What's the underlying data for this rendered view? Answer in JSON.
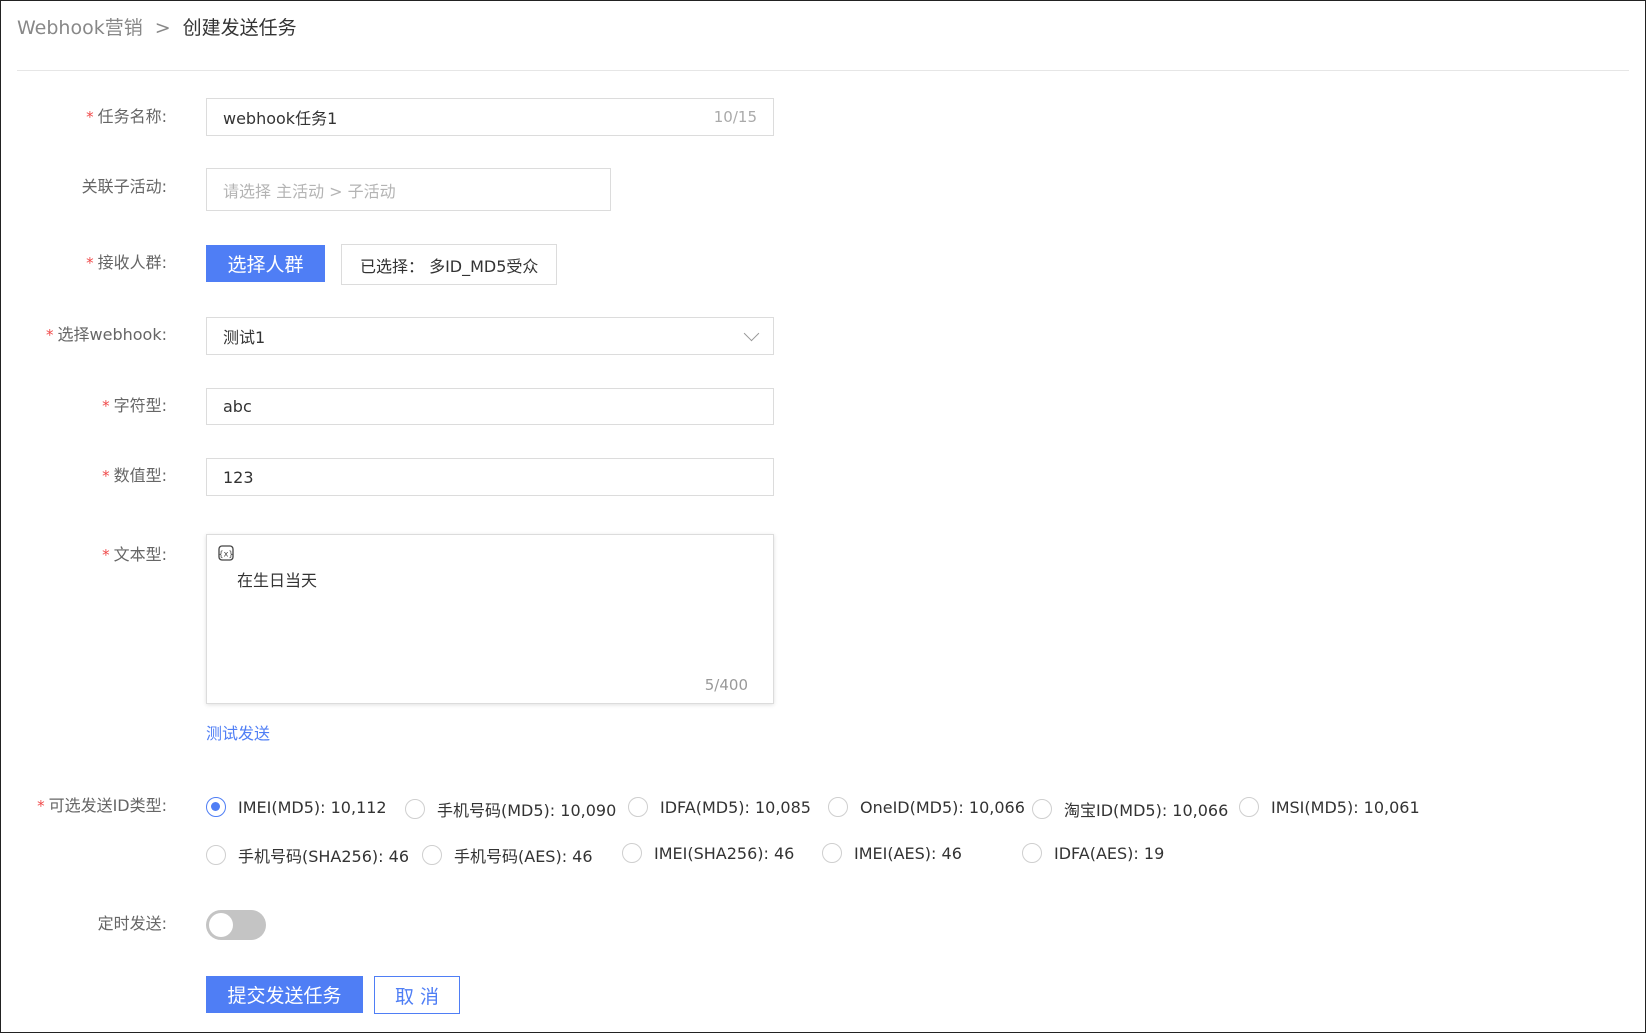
{
  "breadcrumb": {
    "parent": "Webhook营销",
    "separator": ">",
    "current": "创建发送任务"
  },
  "form": {
    "task_name": {
      "label": "任务名称:",
      "value": "webhook任务1",
      "counter": "10/15"
    },
    "sub_activity": {
      "label": "关联子活动:",
      "placeholder": "请选择 主活动 > 子活动"
    },
    "audience": {
      "label": "接收人群:",
      "button": "选择人群",
      "selected": "已选择： 多ID_MD5受众"
    },
    "webhook": {
      "label": "选择webhook:",
      "value": "测试1"
    },
    "string_field": {
      "label": "字符型:",
      "value": "abc"
    },
    "number_field": {
      "label": "数值型:",
      "value": "123"
    },
    "text_field": {
      "label": "文本型:",
      "value": "在生日当天",
      "counter": "5/400",
      "icon": "variable-icon"
    },
    "test_send": "测试发送",
    "id_type": {
      "label": "可选发送ID类型:",
      "options": [
        {
          "label": "IMEI(MD5): 10,112",
          "checked": true
        },
        {
          "label": "手机号码(MD5): 10,090",
          "checked": false
        },
        {
          "label": "IDFA(MD5): 10,085",
          "checked": false
        },
        {
          "label": "OneID(MD5): 10,066",
          "checked": false
        },
        {
          "label": "淘宝ID(MD5): 10,066",
          "checked": false
        },
        {
          "label": "IMSI(MD5): 10,061",
          "checked": false
        },
        {
          "label": "手机号码(SHA256): 46",
          "checked": false
        },
        {
          "label": "手机号码(AES): 46",
          "checked": false
        },
        {
          "label": "IMEI(SHA256): 46",
          "checked": false
        },
        {
          "label": "IMEI(AES): 46",
          "checked": false
        },
        {
          "label": "IDFA(AES): 19",
          "checked": false
        }
      ]
    },
    "schedule": {
      "label": "定时发送:",
      "enabled": false
    },
    "submit": "提交发送任务",
    "cancel": "取 消"
  },
  "colors": {
    "primary": "#4f7ef5",
    "required": "#f04a4a"
  }
}
